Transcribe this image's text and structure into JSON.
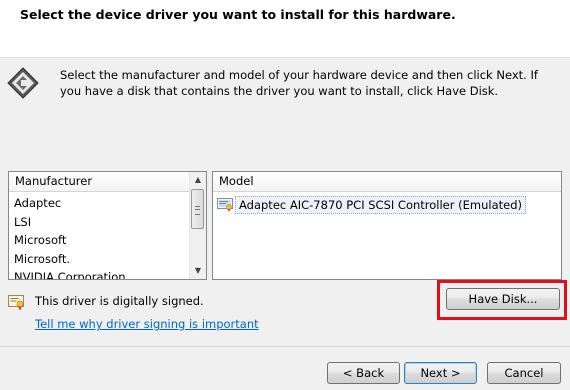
{
  "header": {
    "title": "Select the device driver you want to install for this hardware."
  },
  "instructions": "Select the manufacturer and model of your hardware device and then click Next. If you have a disk that contains the driver you want to install, click Have Disk.",
  "manufacturer_list": {
    "header": "Manufacturer",
    "items": [
      "Adaptec",
      "LSI",
      "Microsoft",
      "Microsoft.",
      "NVIDIA Corporation"
    ]
  },
  "model_list": {
    "header": "Model",
    "items": [
      "Adaptec AIC-7870 PCI SCSI Controller (Emulated)"
    ]
  },
  "signing": {
    "status": "This driver is digitally signed.",
    "link": "Tell me why driver signing is important"
  },
  "buttons": {
    "have_disk": "Have Disk...",
    "back": "< Back",
    "next": "Next >",
    "cancel": "Cancel"
  },
  "colors": {
    "highlight": "#e0101b",
    "link": "#0066cc"
  }
}
